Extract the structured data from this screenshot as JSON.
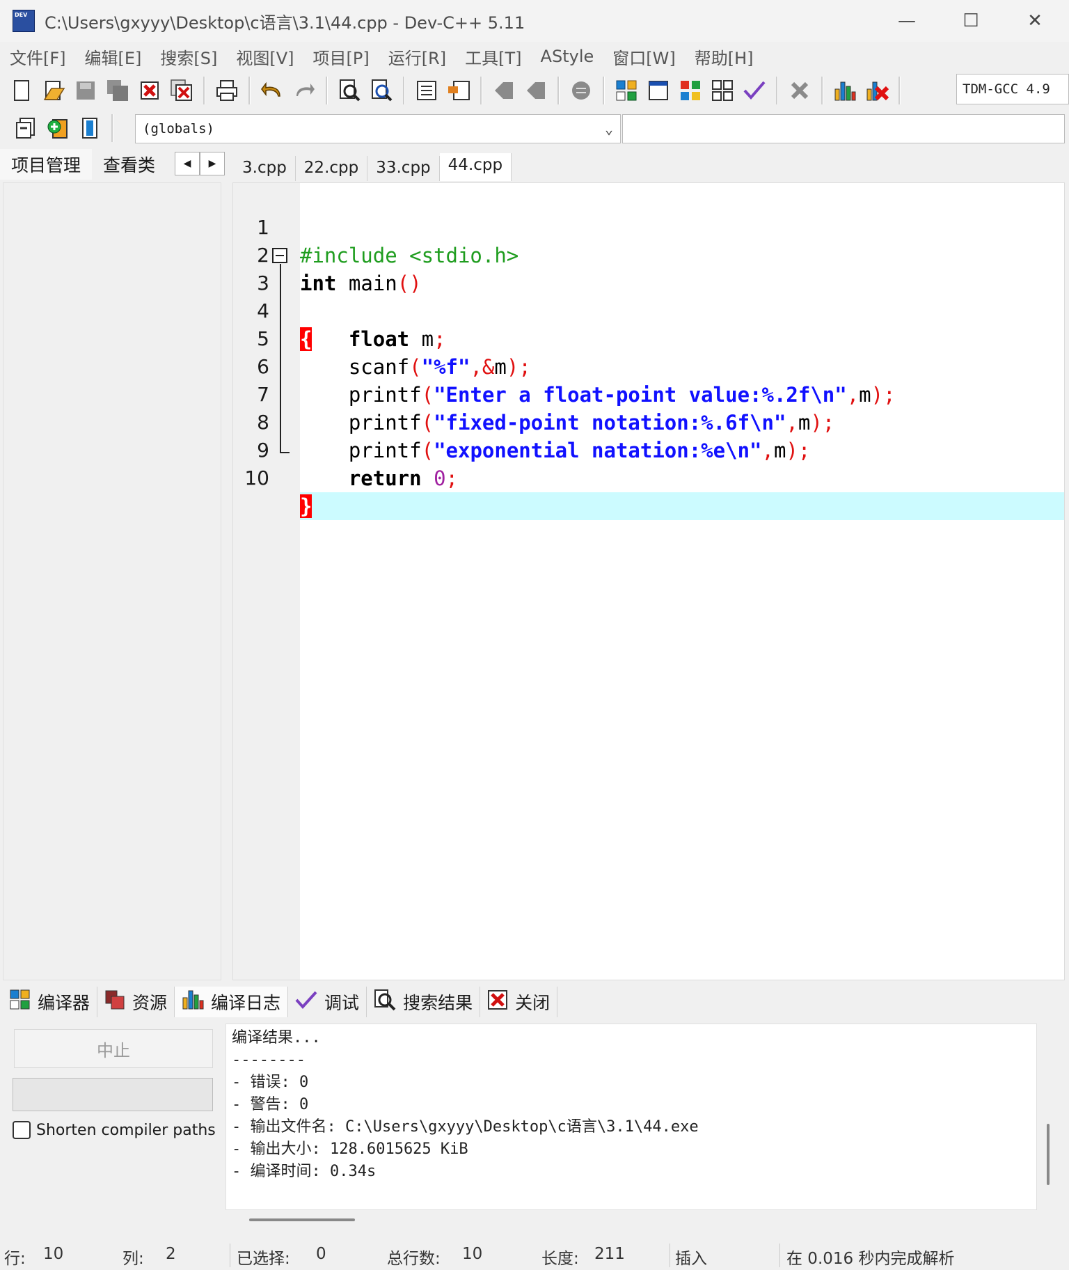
{
  "window": {
    "title": "C:\\Users\\gxyyy\\Desktop\\c语言\\3.1\\44.cpp - Dev-C++ 5.11",
    "controls": {
      "minimize": "—",
      "maximize": "☐",
      "close": "✕"
    }
  },
  "menu": [
    "文件[F]",
    "编辑[E]",
    "搜索[S]",
    "视图[V]",
    "项目[P]",
    "运行[R]",
    "工具[T]",
    "AStyle",
    "窗口[W]",
    "帮助[H]"
  ],
  "toolbar": {
    "compiler": "TDM-GCC 4.9",
    "scope": "(globals)"
  },
  "left_panel": {
    "tabs": [
      "项目管理",
      "查看类"
    ],
    "nav_prev": "◀",
    "nav_next": "▶"
  },
  "editor": {
    "tabs": [
      "3.cpp",
      "22.cpp",
      "33.cpp",
      "44.cpp"
    ],
    "active_tab": "44.cpp",
    "current_line": 10,
    "lines": [
      {
        "n": "1",
        "text": "#include <stdio.h>"
      },
      {
        "n": "2",
        "text": "int main()"
      },
      {
        "n": "3",
        "text": "{"
      },
      {
        "n": "4",
        "text": "    float m;"
      },
      {
        "n": "5",
        "text": "    scanf(\"%f\",&m);"
      },
      {
        "n": "6",
        "text": "    printf(\"Enter a float-point value:%.2f\\n\",m);"
      },
      {
        "n": "7",
        "text": "    printf(\"fixed-point notation:%.6f\\n\",m);"
      },
      {
        "n": "8",
        "text": "    printf(\"exponential natation:%e\\n\",m);"
      },
      {
        "n": "9",
        "text": "    return 0;"
      },
      {
        "n": "10",
        "text": "}"
      }
    ]
  },
  "bottom_panel": {
    "tabs": [
      "编译器",
      "资源",
      "编译日志",
      "调试",
      "搜索结果",
      "关闭"
    ],
    "active_tab": "编译日志",
    "stop_label": "中止",
    "shorten_label": "Shorten compiler paths",
    "shorten_checked": false,
    "log": [
      "编译结果...",
      "--------",
      "- 错误: 0",
      "- 警告: 0",
      "- 输出文件名: C:\\Users\\gxyyy\\Desktop\\c语言\\3.1\\44.exe",
      "- 输出大小: 128.6015625 KiB",
      "- 编译时间: 0.34s"
    ]
  },
  "status": {
    "row_label": "行:",
    "row": "10",
    "col_label": "列:",
    "col": "2",
    "sel_label": "已选择:",
    "sel": "0",
    "lines_label": "总行数:",
    "lines": "10",
    "len_label": "长度:",
    "len": "211",
    "mode": "插入",
    "parse": "在 0.016 秒内完成解析"
  },
  "colors": {
    "highlight_line": "#ccfbff",
    "brace_bg": "#ff0000",
    "string": "#1010ff",
    "preprocessor": "#1f9d1f"
  }
}
